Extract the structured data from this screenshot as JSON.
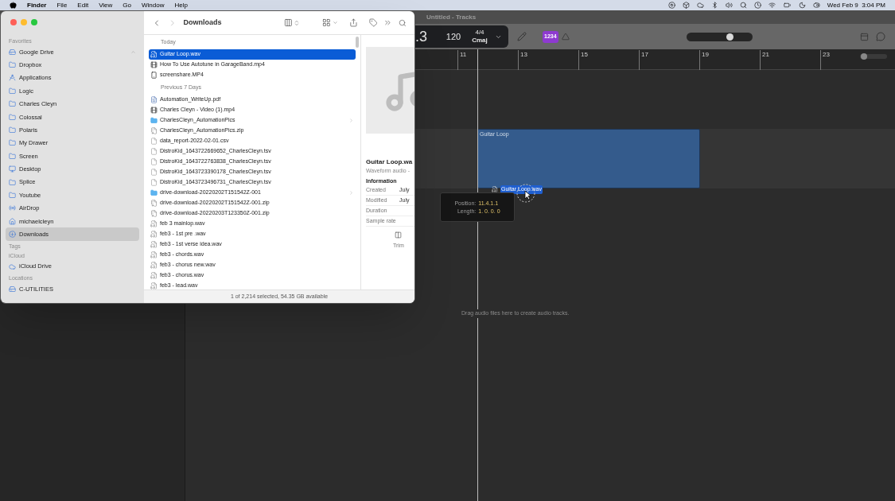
{
  "menu_bar": {
    "app": "Finder",
    "menus": [
      "File",
      "Edit",
      "View",
      "Go",
      "Window",
      "Help"
    ],
    "clock": "Wed Feb 9  3:04 PM"
  },
  "logic": {
    "title": "Untitled - Tracks",
    "lcd": {
      "position": ".3",
      "tempo": "120",
      "signature": "4/4",
      "key": "Cmaj"
    },
    "count_in": "1234",
    "master_volume": {
      "level": 0.68
    },
    "zoom": {
      "level": 0.05
    },
    "ruler": [
      "11",
      "13",
      "15",
      "17",
      "19",
      "21",
      "23"
    ],
    "region": "Guitar Loop",
    "drag_file": "Guitar Loop.wav",
    "tooltip": [
      {
        "label": "Position:",
        "value": "11.4.1.1"
      },
      {
        "label": "Length:",
        "value": "1. 0. 0. 0"
      }
    ],
    "hint": "Drag audio files here to create audio tracks."
  },
  "finder": {
    "title": "Downloads",
    "sidebar": [
      {
        "heading": "Favorites",
        "items": [
          {
            "label": "Google Drive",
            "kind": "drive",
            "selected": false
          },
          {
            "label": "Dropbox",
            "kind": "folder",
            "selected": false
          },
          {
            "label": "Applications",
            "kind": "apps",
            "selected": false
          },
          {
            "label": "Logic",
            "kind": "folder",
            "selected": false
          },
          {
            "label": "Charles Cleyn",
            "kind": "folder",
            "selected": false
          },
          {
            "label": "Colossal",
            "kind": "folder",
            "selected": false
          },
          {
            "label": "Polaris",
            "kind": "folder",
            "selected": false
          },
          {
            "label": "My Drawer",
            "kind": "folder",
            "selected": false
          },
          {
            "label": "Screen",
            "kind": "folder",
            "selected": false
          },
          {
            "label": "Desktop",
            "kind": "desktop",
            "selected": false
          },
          {
            "label": "Splice",
            "kind": "folder",
            "selected": false
          },
          {
            "label": "Youtube",
            "kind": "folder",
            "selected": false
          },
          {
            "label": "AirDrop",
            "kind": "airdrop",
            "selected": false
          },
          {
            "label": "michaelcleyn",
            "kind": "home",
            "selected": false
          },
          {
            "label": "Downloads",
            "kind": "download",
            "selected": true
          }
        ]
      },
      {
        "heading": "Tags"
      },
      {
        "heading": "iCloud",
        "items": [
          {
            "label": "iCloud Drive",
            "kind": "cloud",
            "selected": false
          }
        ]
      },
      {
        "heading": "Locations",
        "items": [
          {
            "label": "C-UTILITIES",
            "kind": "disk",
            "selected": false
          }
        ]
      }
    ],
    "groups": [
      {
        "heading": "Today",
        "files": [
          {
            "name": "Guitar Loop.wav",
            "kind": "audio",
            "selected": true
          },
          {
            "name": "How To Use Autotune in GarageBand.mp4",
            "kind": "video",
            "selected": false
          },
          {
            "name": "screenshare.MP4",
            "kind": "phone",
            "selected": false
          }
        ]
      },
      {
        "heading": "Previous 7 Days",
        "files": [
          {
            "name": "Automation_WriteUp.pdf",
            "kind": "pdf",
            "selected": false
          },
          {
            "name": "Charles Cleyn - Video (1).mp4",
            "kind": "video",
            "selected": false
          },
          {
            "name": "CharlesCleyn_AutomationPics",
            "kind": "folder",
            "selected": false
          },
          {
            "name": "CharlesCleyn_AutomationPics.zip",
            "kind": "zip",
            "selected": false
          },
          {
            "name": "data_report-2022-02-01.csv",
            "kind": "doc",
            "selected": false
          },
          {
            "name": "DistroKid_1643722669652_CharlesCleyn.tsv",
            "kind": "doc",
            "selected": false
          },
          {
            "name": "DistroKid_1643722763838_CharlesCleyn.tsv",
            "kind": "doc",
            "selected": false
          },
          {
            "name": "DistroKid_1643723390178_CharlesCleyn.tsv",
            "kind": "doc",
            "selected": false
          },
          {
            "name": "DistroKid_1643723496731_CharlesCleyn.tsv",
            "kind": "doc",
            "selected": false
          },
          {
            "name": "drive-download-20220202T151542Z-001",
            "kind": "folder",
            "selected": false
          },
          {
            "name": "drive-download-20220202T151542Z-001.zip",
            "kind": "zip",
            "selected": false
          },
          {
            "name": "drive-download-20220203T123350Z-001.zip",
            "kind": "zip",
            "selected": false
          },
          {
            "name": "feb 3 mainlop.wav",
            "kind": "audio",
            "selected": false
          },
          {
            "name": "feb3 - 1st pre .wav",
            "kind": "audio",
            "selected": false
          },
          {
            "name": "feb3 - 1st verse idea.wav",
            "kind": "audio",
            "selected": false
          },
          {
            "name": "feb3 - chords.wav",
            "kind": "audio",
            "selected": false
          },
          {
            "name": "feb3 - chorus new.wav",
            "kind": "audio",
            "selected": false
          },
          {
            "name": "feb3 - chorus.wav",
            "kind": "audio",
            "selected": false
          },
          {
            "name": "feb3 - lead.wav",
            "kind": "audio",
            "selected": false
          }
        ]
      }
    ],
    "preview": {
      "name": "Guitar Loop.wa",
      "type": "Waveform audio -",
      "info_heading": "Information",
      "info": [
        {
          "label": "Created",
          "value": "July"
        },
        {
          "label": "Modified",
          "value": "July"
        },
        {
          "label": "Duration"
        },
        {
          "label": "Sample rate"
        }
      ],
      "action": "Trim"
    },
    "status": "1 of 2,214 selected, 54.35 GB available"
  }
}
